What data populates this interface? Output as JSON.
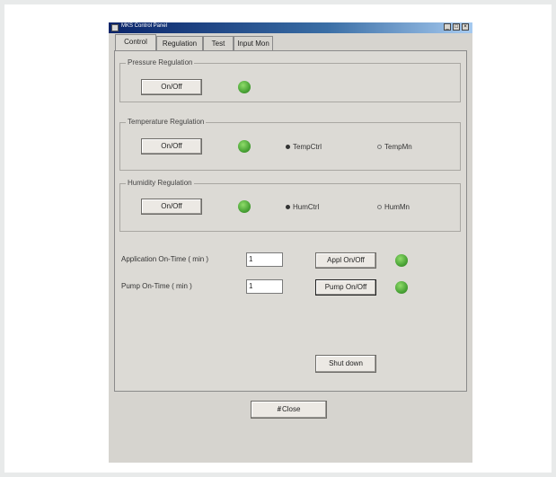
{
  "window": {
    "title": "MKS Control Panel",
    "controls": [
      "_",
      "□",
      "×"
    ]
  },
  "tabs": [
    "Control",
    "Regulation",
    "Test",
    "Input Mon"
  ],
  "groups": {
    "pressure": {
      "label": "Pressure Regulation",
      "button": "On/Off"
    },
    "temperature": {
      "label": "Temperature Regulation",
      "button": "On/Off",
      "radio_selected": "TempCtrl",
      "radio_other": "TempMn"
    },
    "humidity": {
      "label": "Humidity Regulation",
      "button": "On/Off",
      "radio_selected": "HumCtrl",
      "radio_other": "HumMn"
    }
  },
  "application": {
    "label": "Application On-Time ( min )",
    "value": "1",
    "button": "Appl On/Off"
  },
  "pump": {
    "label": "Pump On-Time ( min )",
    "value": "1",
    "button": "Pump On/Off"
  },
  "shutdown_button": "Shut down",
  "close_button": {
    "accel": "#",
    "label": "Close"
  },
  "colors": {
    "led_on": "#4aa336",
    "title_bar": "#0a246a"
  }
}
